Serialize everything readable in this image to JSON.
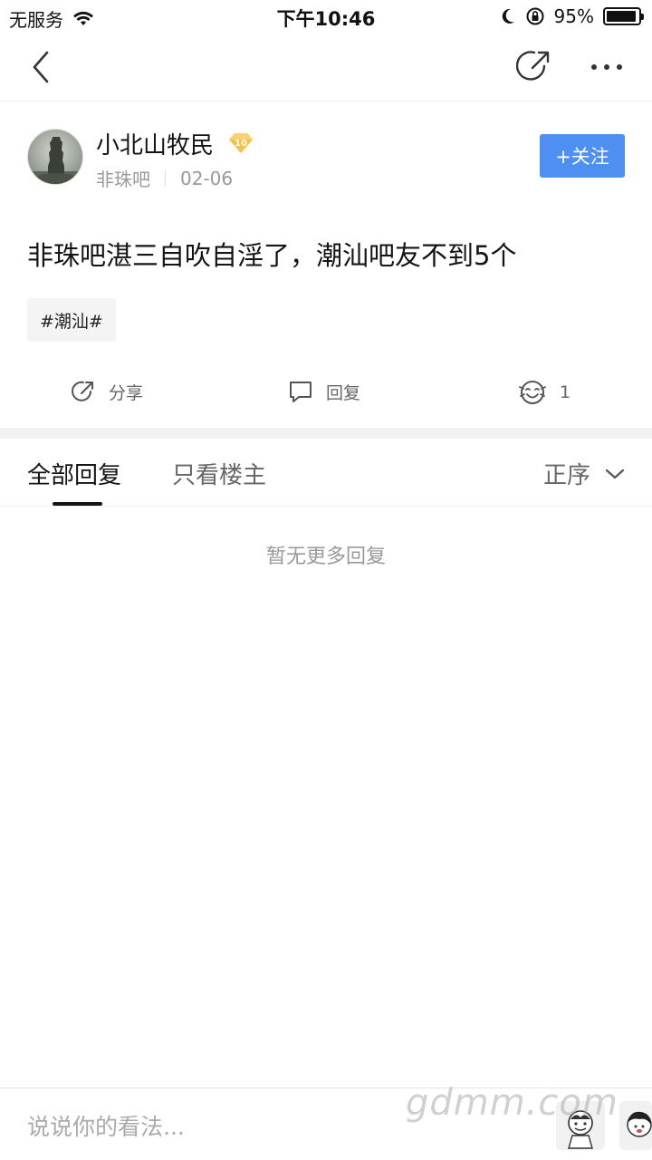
{
  "status_bar": {
    "carrier": "无服务",
    "time": "下午10:46",
    "battery_text": "95%",
    "battery_level": 0.95
  },
  "post": {
    "author_name": "小北山牧民",
    "level": "10",
    "forum": "非珠吧",
    "date": "02-06",
    "follow_label": "+关注",
    "title": "非珠吧湛三自吹自淫了，潮汕吧友不到5个",
    "topic": "#潮汕#"
  },
  "actions": {
    "share_label": "分享",
    "reply_label": "回复",
    "like_count": "1"
  },
  "tabs": {
    "all_replies": "全部回复",
    "owner_only": "只看楼主",
    "sort_label": "正序"
  },
  "empty_text": "暂无更多回复",
  "comment": {
    "placeholder": "说说你的看法..."
  },
  "watermark": "gdmm.com",
  "colors": {
    "accent": "#4e8ff2",
    "level_badge": "#f0c24a"
  }
}
